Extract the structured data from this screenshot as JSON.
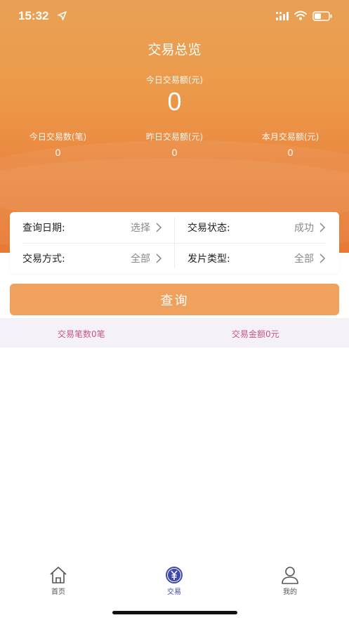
{
  "status_bar": {
    "time": "15:32"
  },
  "overview": {
    "title": "交易总览",
    "today_amount_label": "今日交易额(元)",
    "today_amount_value": "0",
    "stats": [
      {
        "label": "今日交易数(笔)",
        "value": "0"
      },
      {
        "label": "昨日交易额(元)",
        "value": "0"
      },
      {
        "label": "本月交易额(元)",
        "value": "0"
      }
    ]
  },
  "filters": {
    "date": {
      "label": "查询日期:",
      "value": "选择"
    },
    "status": {
      "label": "交易状态:",
      "value": "成功"
    },
    "method": {
      "label": "交易方式:",
      "value": "全部"
    },
    "card_type": {
      "label": "发片类型:",
      "value": "全部"
    }
  },
  "query_button": {
    "label": "查询"
  },
  "summary": {
    "count_text": "交易笔数0笔",
    "amount_text": "交易金额0元"
  },
  "tabbar": {
    "items": [
      {
        "label": "首页",
        "icon": "home-icon",
        "active": false
      },
      {
        "label": "交易",
        "icon": "yuan-coin-icon",
        "active": true
      },
      {
        "label": "我的",
        "icon": "user-icon",
        "active": false
      }
    ]
  },
  "colors": {
    "hero_top": "#eaa155",
    "hero_bottom": "#e77a35",
    "button": "#efa15d",
    "summary_text": "#c5587c",
    "tab_active": "#4048a8"
  }
}
